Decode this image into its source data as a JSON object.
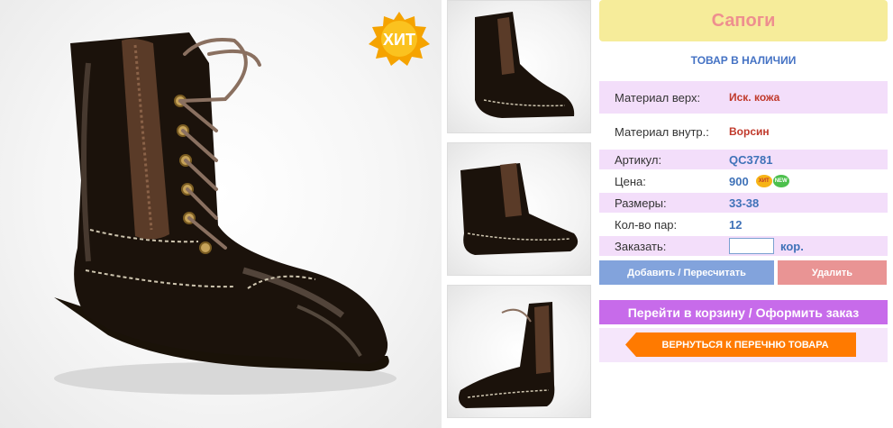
{
  "product": {
    "title": "Сапоги",
    "stock_status": "ТОВАР В НАЛИЧИИ",
    "hit_badge": "ХИТ"
  },
  "details": {
    "material_top_label": "Материал верх:",
    "material_top_value": "Иск. кожа",
    "material_inner_label": "Материал внутр.:",
    "material_inner_value": "Ворсин",
    "article_label": "Артикул:",
    "article_value": "QC3781",
    "price_label": "Цена:",
    "price_value": "900",
    "price_badge_hit": "ХИТ",
    "price_badge_new": "NEW",
    "sizes_label": "Размеры:",
    "sizes_value": "33-38",
    "pairs_label": "Кол-во пар:",
    "pairs_value": "12",
    "order_label": "Заказать:",
    "order_value": "",
    "order_unit": "кор."
  },
  "buttons": {
    "add": "Добавить / Пересчитать",
    "delete": "Удалить",
    "cart": "Перейти в корзину / Оформить заказ",
    "back": "ВЕРНУТЬСЯ К ПЕРЕЧНЮ ТОВАРА"
  },
  "colors": {
    "title_bg": "#f6ec9a",
    "title_text": "#ee8f8f",
    "row_shade": "#f3defa",
    "add_button": "#82a3dc",
    "delete_button": "#e99494",
    "cart_button": "#c76bea",
    "back_button": "#ff7a00"
  }
}
